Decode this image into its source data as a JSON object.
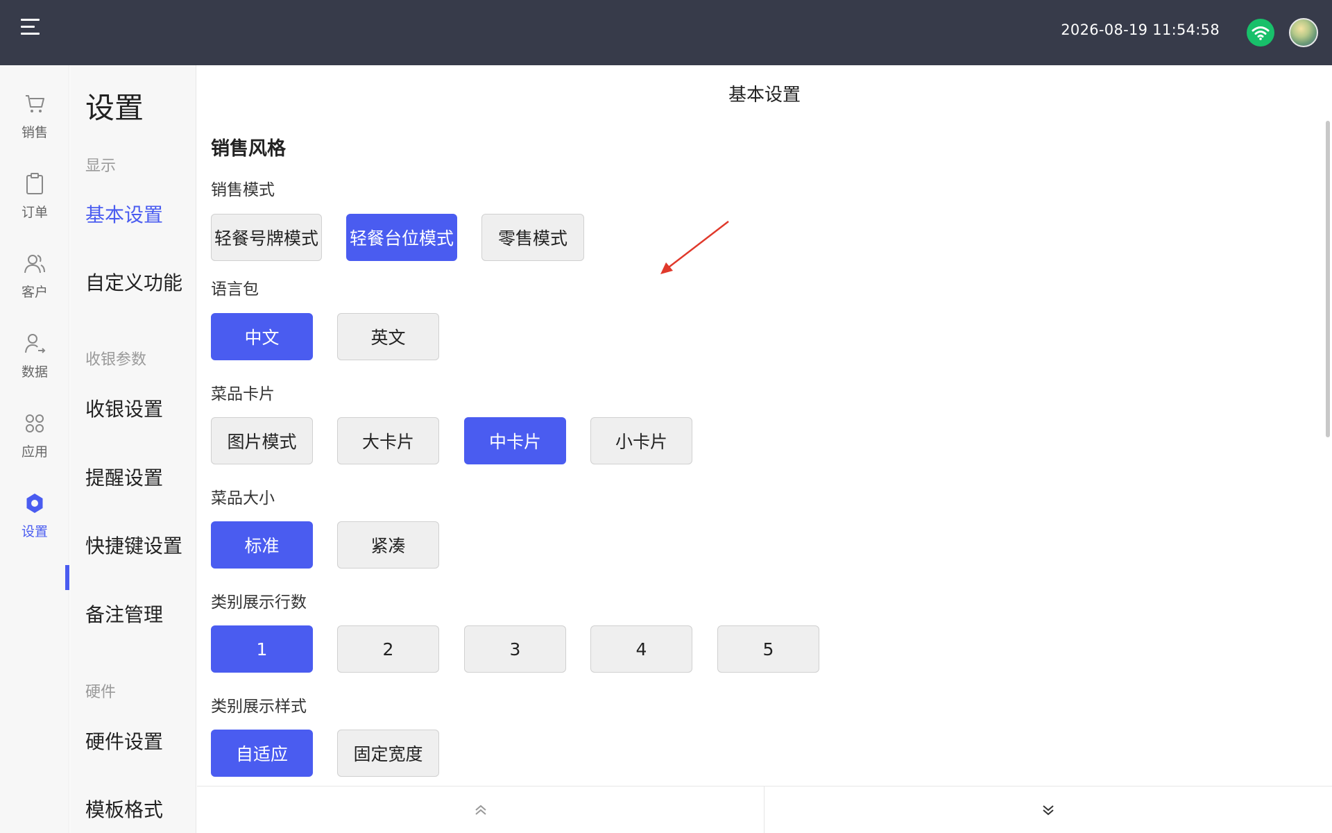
{
  "header": {
    "datetime": "2026-08-19 11:54:58"
  },
  "rail": {
    "items": [
      {
        "label": "销售",
        "icon": "cart-icon"
      },
      {
        "label": "订单",
        "icon": "clipboard-icon"
      },
      {
        "label": "客户",
        "icon": "users-icon"
      },
      {
        "label": "数据",
        "icon": "user-data-icon"
      },
      {
        "label": "应用",
        "icon": "apps-icon"
      },
      {
        "label": "设置",
        "icon": "gear-icon"
      }
    ],
    "active_index": 5
  },
  "sidemenu": {
    "title": "设置",
    "groups": {
      "display": "显示",
      "cashier_params": "收银参数",
      "hardware": "硬件"
    },
    "items": {
      "basic_settings": "基本设置",
      "custom_functions": "自定义功能",
      "cashier_settings": "收银设置",
      "reminder_settings": "提醒设置",
      "shortcut_settings": "快捷键设置",
      "note_management": "备注管理",
      "hardware_settings": "硬件设置",
      "template_format": "模板格式"
    }
  },
  "main": {
    "title": "基本设置",
    "section_title": "销售风格",
    "rows": {
      "sales_mode": {
        "label": "销售模式",
        "options": [
          "轻餐号牌模式",
          "轻餐台位模式",
          "零售模式"
        ],
        "selected": 1
      },
      "language": {
        "label": "语言包",
        "options": [
          "中文",
          "英文"
        ],
        "selected": 0
      },
      "dish_card": {
        "label": "菜品卡片",
        "options": [
          "图片模式",
          "大卡片",
          "中卡片",
          "小卡片"
        ],
        "selected": 2
      },
      "dish_size": {
        "label": "菜品大小",
        "options": [
          "标准",
          "紧凑"
        ],
        "selected": 0
      },
      "category_rows": {
        "label": "类别展示行数",
        "options": [
          "1",
          "2",
          "3",
          "4",
          "5"
        ],
        "selected": 0
      },
      "category_style": {
        "label": "类别展示样式",
        "options": [
          "自适应",
          "固定宽度"
        ],
        "selected": 0
      }
    }
  },
  "colors": {
    "accent": "#4a5cf0",
    "topbar": "#373b4a",
    "wifi": "#18c06a",
    "annotation_arrow": "#e0392b"
  }
}
